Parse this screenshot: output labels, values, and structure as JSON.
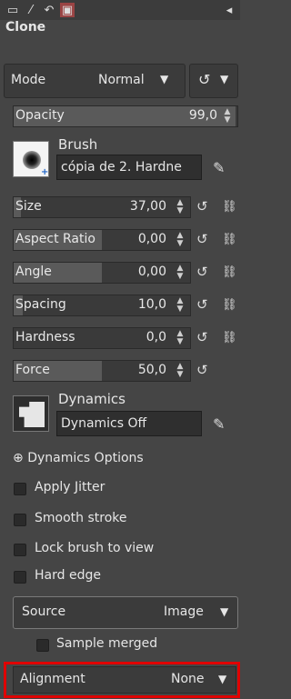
{
  "tool_title": "Clone",
  "mode": {
    "label": "Mode",
    "value": "Normal"
  },
  "opacity": {
    "label": "Opacity",
    "value": "99,0",
    "fraction": 0.99
  },
  "brush": {
    "title": "Brush",
    "name": "cópia de 2. Hardne"
  },
  "sliders": [
    {
      "label": "Size",
      "value": "37,00",
      "fraction": 0.04
    },
    {
      "label": "Aspect Ratio",
      "value": "0,00",
      "fraction": 0.5
    },
    {
      "label": "Angle",
      "value": "0,00",
      "fraction": 0.5
    },
    {
      "label": "Spacing",
      "value": "10,0",
      "fraction": 0.05
    },
    {
      "label": "Hardness",
      "value": "0,0",
      "fraction": 0.0
    },
    {
      "label": "Force",
      "value": "50,0",
      "fraction": 0.5
    }
  ],
  "dynamics": {
    "title": "Dynamics",
    "name": "Dynamics Off"
  },
  "dynamics_options": "Dynamics Options",
  "checkboxes": [
    {
      "label": "Apply Jitter"
    },
    {
      "label": "Smooth stroke"
    },
    {
      "label": "Lock brush to view"
    },
    {
      "label": "Hard edge"
    }
  ],
  "source": {
    "label": "Source",
    "value": "Image"
  },
  "sample_merged": "Sample merged",
  "alignment": {
    "label": "Alignment",
    "value": "None"
  },
  "colors": {
    "highlight": "#e00000"
  }
}
